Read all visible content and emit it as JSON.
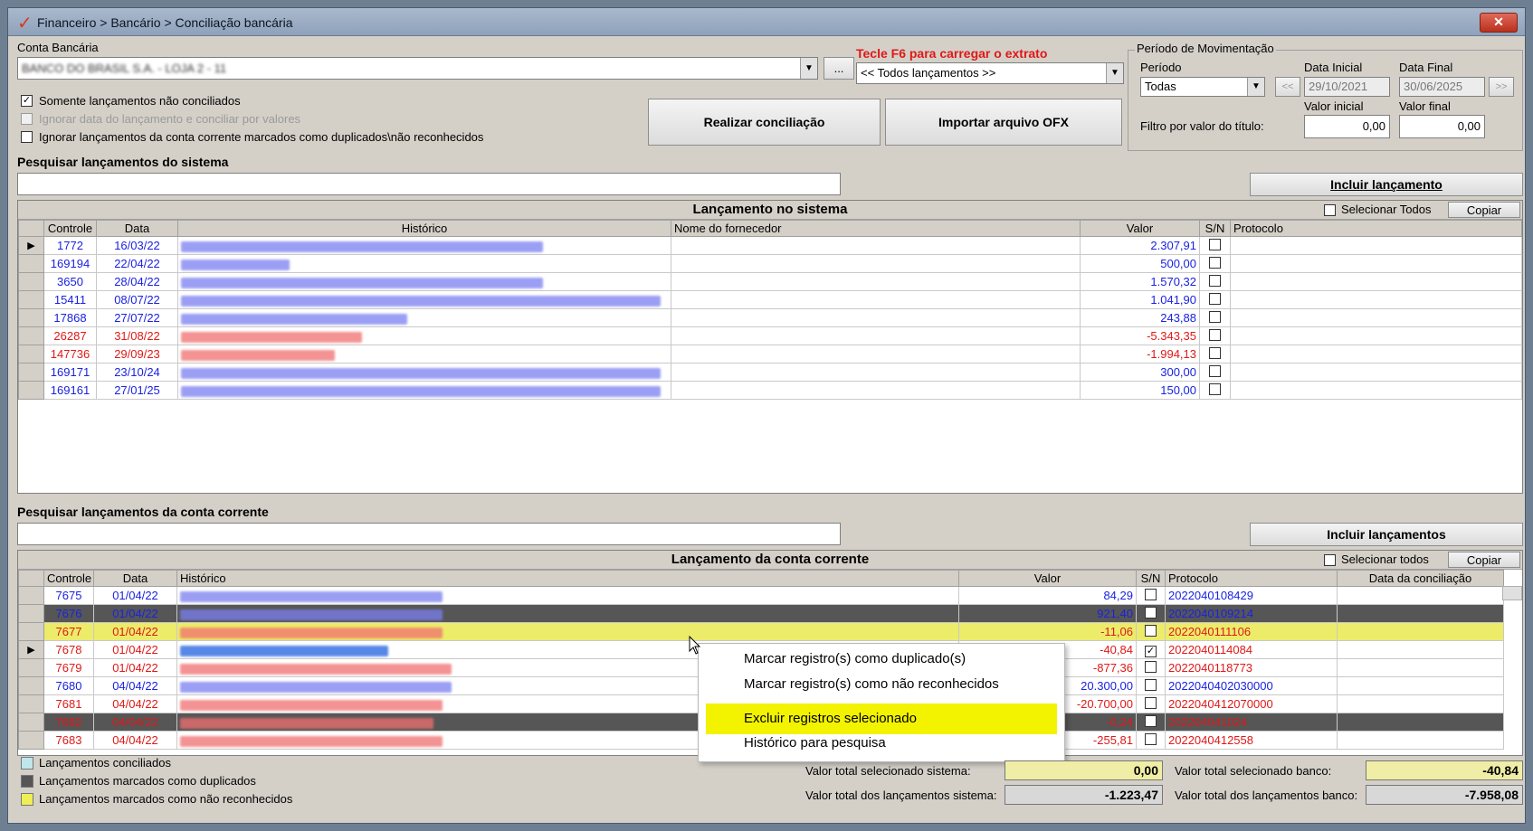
{
  "window": {
    "title": "Financeiro > Bancário > Conciliação bancária",
    "close": "✕"
  },
  "conta": {
    "label": "Conta Bancária",
    "value": "BANCO DO BRASIL S.A. - LOJA 2 - 11",
    "browse": "..."
  },
  "f6": {
    "label": "Tecle F6 para carregar o extrato",
    "value": "<< Todos lançamentos >>"
  },
  "periodo": {
    "group": "Período de Movimentação",
    "periodo_label": "Período",
    "periodo_value": "Todas",
    "data_inicial_label": "Data Inicial",
    "data_inicial": "29/10/2021",
    "data_final_label": "Data Final",
    "data_final": "30/06/2025",
    "prev": "<<",
    "next": ">>",
    "valor_inicial_label": "Valor inicial",
    "valor_inicial": "0,00",
    "valor_final_label": "Valor final",
    "valor_final": "0,00",
    "filtro_label": "Filtro por valor do título:"
  },
  "options": {
    "somente": "Somente lançamentos não conciliados",
    "ignorar_data": "Ignorar data do lançamento e conciliar por valores",
    "ignorar_dup": "Ignorar lançamentos da conta corrente marcados como duplicados\\não reconhecidos"
  },
  "buttons": {
    "realizar": "Realizar conciliação",
    "importar": "Importar arquivo OFX",
    "incluir_sistema": "Incluir lançamento",
    "incluir_cc": "Incluir lançamentos",
    "copiar": "Copiar"
  },
  "search_sistema": {
    "label": "Pesquisar lançamentos do sistema",
    "value": ""
  },
  "search_cc": {
    "label": "Pesquisar lançamentos da conta corrente",
    "value": ""
  },
  "sistema": {
    "title": "Lançamento no sistema",
    "select_all": "Selecionar Todos",
    "columns": [
      "Controle",
      "Data",
      "Histórico",
      "Nome do fornecedor",
      "Valor",
      "S/N",
      "Protocolo"
    ],
    "rows": [
      {
        "controle": "1772",
        "data": "16/03/22",
        "valor": "2.307,91",
        "color": "blue",
        "sel": true
      },
      {
        "controle": "169194",
        "data": "22/04/22",
        "valor": "500,00",
        "color": "blue"
      },
      {
        "controle": "3650",
        "data": "28/04/22",
        "valor": "1.570,32",
        "color": "blue"
      },
      {
        "controle": "15411",
        "data": "08/07/22",
        "valor": "1.041,90",
        "color": "blue"
      },
      {
        "controle": "17868",
        "data": "27/07/22",
        "valor": "243,88",
        "color": "blue"
      },
      {
        "controle": "26287",
        "data": "31/08/22",
        "valor": "-5.343,35",
        "color": "red"
      },
      {
        "controle": "147736",
        "data": "29/09/23",
        "valor": "-1.994,13",
        "color": "red"
      },
      {
        "controle": "169171",
        "data": "23/10/24",
        "valor": "300,00",
        "color": "blue"
      },
      {
        "controle": "169161",
        "data": "27/01/25",
        "valor": "150,00",
        "color": "blue"
      }
    ]
  },
  "cc": {
    "title": "Lançamento da conta corrente",
    "select_all": "Selecionar todos",
    "columns": [
      "Controle",
      "Data",
      "Histórico",
      "Valor",
      "S/N",
      "Protocolo",
      "Data da conciliação"
    ],
    "rows": [
      {
        "controle": "7675",
        "data": "01/04/22",
        "valor": "84,29",
        "protocolo": "2022040108429",
        "color": "blue",
        "style": ""
      },
      {
        "controle": "7676",
        "data": "01/04/22",
        "valor": "921,40",
        "protocolo": "2022040109214",
        "color": "blue",
        "style": "dark"
      },
      {
        "controle": "7677",
        "data": "01/04/22",
        "valor": "-11,06",
        "protocolo": "2022040111106",
        "color": "red",
        "style": "yellow"
      },
      {
        "controle": "7678",
        "data": "01/04/22",
        "valor": "-40,84",
        "protocolo": "2022040114084",
        "color": "red",
        "style": "",
        "checked": true,
        "sel": true
      },
      {
        "controle": "7679",
        "data": "01/04/22",
        "valor": "-877,36",
        "protocolo": "2022040118773",
        "color": "red",
        "style": ""
      },
      {
        "controle": "7680",
        "data": "04/04/22",
        "valor": "20.300,00",
        "protocolo": "2022040402030000",
        "color": "blue",
        "style": ""
      },
      {
        "controle": "7681",
        "data": "04/04/22",
        "valor": "-20.700,00",
        "protocolo": "2022040412070000",
        "color": "red",
        "style": ""
      },
      {
        "controle": "7682",
        "data": "04/04/22",
        "valor": "-0,24",
        "protocolo": "202204041024",
        "color": "red",
        "style": "dark"
      },
      {
        "controle": "7683",
        "data": "04/04/22",
        "valor": "-255,81",
        "protocolo": "2022040412558",
        "color": "red",
        "style": ""
      }
    ]
  },
  "context_menu": [
    "Marcar registro(s) como duplicado(s)",
    "Marcar registro(s) como não reconhecidos",
    "Excluir registros selecionado",
    "Histórico para pesquisa"
  ],
  "legend": [
    {
      "label": "Lançamentos conciliados",
      "color": "#bfe6ea"
    },
    {
      "label": "Lançamentos marcados como duplicados",
      "color": "#555555"
    },
    {
      "label": "Lançamentos marcados como não reconhecidos",
      "color": "#eeee55"
    }
  ],
  "totals": {
    "sel_sistema_label": "Valor total selecionado sistema:",
    "sel_sistema": "0,00",
    "tot_sistema_label": "Valor total dos lançamentos sistema:",
    "tot_sistema": "-1.223,47",
    "sel_banco_label": "Valor total selecionado banco:",
    "sel_banco": "-40,84",
    "tot_banco_label": "Valor total dos lançamentos banco:",
    "tot_banco": "-7.958,08"
  }
}
